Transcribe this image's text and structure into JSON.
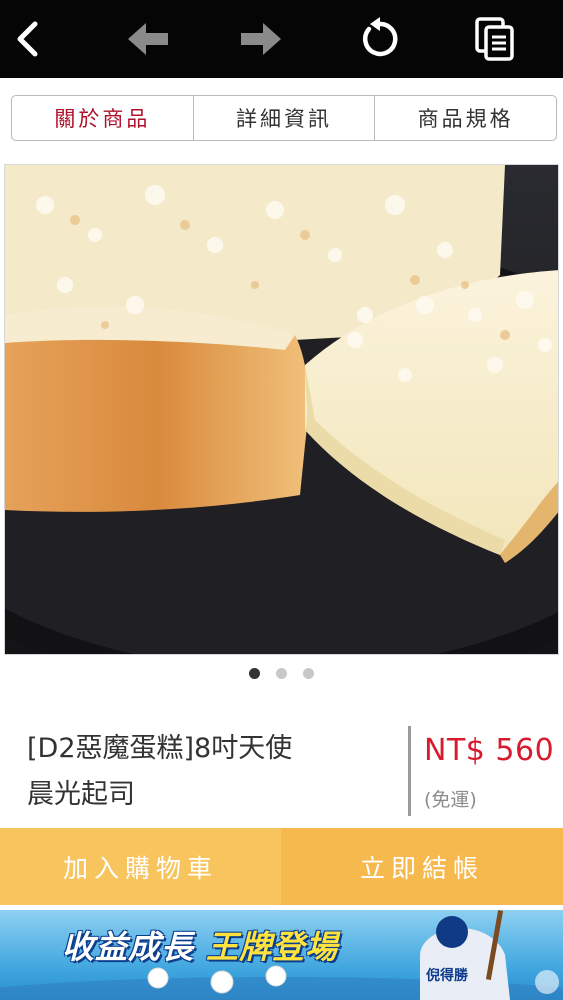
{
  "toolbar": {
    "back_icon": "chevron-left-icon",
    "prev_icon": "arrow-left-icon",
    "next_icon": "arrow-right-icon",
    "reload_icon": "refresh-icon",
    "copy_icon": "document-copy-icon"
  },
  "tabs": [
    {
      "label": "關於商品",
      "active": true
    },
    {
      "label": "詳細資訊",
      "active": false
    },
    {
      "label": "商品規格",
      "active": false
    }
  ],
  "carousel": {
    "count": 3,
    "active_index": 0
  },
  "product": {
    "name_line1": "[D2惡魔蛋糕]8吋天使",
    "name_line2": "晨光起司",
    "price": "NT$ 560",
    "shipping": "(免運)"
  },
  "actions": {
    "add_to_cart": "加入購物車",
    "checkout": "立即結帳"
  },
  "ad": {
    "slogan_part1": "收益成長",
    "slogan_part2": "王牌登場",
    "player_name": "倪得勝"
  },
  "colors": {
    "accent_red": "#d81b2c",
    "tab_active": "#b0102a",
    "button_yellow": "#f7c45d",
    "button_orange": "#f6b94d"
  }
}
